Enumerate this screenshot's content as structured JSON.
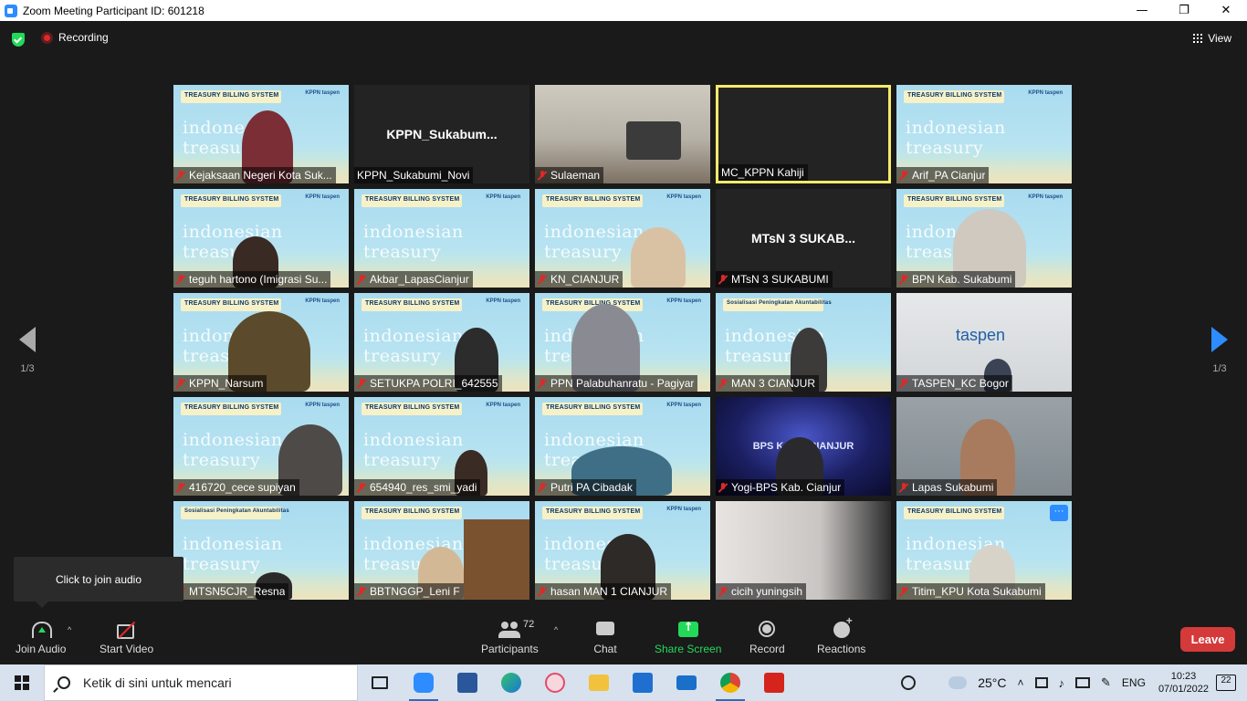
{
  "window": {
    "title": "Zoom Meeting Participant ID: 601218",
    "minimize": "—",
    "maximize": "❐",
    "close": "✕"
  },
  "topbar": {
    "recording_label": "Recording",
    "view_label": "View"
  },
  "pager": {
    "left_label": "1/3",
    "right_label": "1/3"
  },
  "banner": {
    "treasury": "TREASURY BILLING SYSTEM",
    "sosialisasi": "Sosialisasi Peningkatan Akuntabilitas",
    "logo": "KPPN  taspen",
    "watermark": "indonesian treasury"
  },
  "tiles": [
    {
      "name": "Kejaksaan Negeri Kota Suk...",
      "center": "",
      "muted": true
    },
    {
      "name": "KPPN_Sukabumi_Novi",
      "center": "KPPN_Sukabum...",
      "muted": false
    },
    {
      "name": "Sulaeman",
      "center": "",
      "muted": true
    },
    {
      "name": "MC_KPPN Kahiji",
      "center": "",
      "muted": false
    },
    {
      "name": "Arif_PA Cianjur",
      "center": "",
      "muted": true
    },
    {
      "name": "teguh hartono (Imigrasi Su...",
      "center": "",
      "muted": true
    },
    {
      "name": "Akbar_LapasCianjur",
      "center": "",
      "muted": true
    },
    {
      "name": "KN_CIANJUR",
      "center": "",
      "muted": true
    },
    {
      "name": "MTsN 3 SUKABUMI",
      "center": "MTsN 3 SUKAB...",
      "muted": true
    },
    {
      "name": "BPN Kab. Sukabumi",
      "center": "",
      "muted": true
    },
    {
      "name": "KPPN_Narsum",
      "center": "",
      "muted": true
    },
    {
      "name": "SETUKPA POLRI_642555",
      "center": "",
      "muted": true
    },
    {
      "name": "PPN Palabuhanratu - Pagiyar",
      "center": "",
      "muted": true
    },
    {
      "name": "MAN 3 CIANJUR",
      "center": "",
      "muted": true
    },
    {
      "name": "TASPEN_KC Bogor",
      "center": "taspen",
      "muted": true
    },
    {
      "name": "416720_cece supiyan",
      "center": "",
      "muted": true
    },
    {
      "name": "654940_res_smi_yadi",
      "center": "",
      "muted": true
    },
    {
      "name": "Putri PA Cibadak",
      "center": "",
      "muted": true
    },
    {
      "name": "Yogi-BPS Kab. Cianjur",
      "center": "BPS K      TEN CIANJUR",
      "muted": true
    },
    {
      "name": "Lapas Sukabumi",
      "center": "",
      "muted": true
    },
    {
      "name": "MTSN5CJR_Resna",
      "center": "",
      "muted": true
    },
    {
      "name": "BBTNGGP_Leni F",
      "center": "",
      "muted": true
    },
    {
      "name": "hasan MAN 1 CIANJUR",
      "center": "",
      "muted": true
    },
    {
      "name": "cicih yuningsih",
      "center": "",
      "muted": true
    },
    {
      "name": "Titim_KPU Kota Sukabumi",
      "center": "",
      "muted": true
    }
  ],
  "tooltip": {
    "text": "Click to join audio"
  },
  "toolbar": {
    "join_audio": "Join Audio",
    "start_video": "Start Video",
    "participants": "Participants",
    "participants_count": "72",
    "chat": "Chat",
    "share_screen": "Share Screen",
    "record": "Record",
    "reactions": "Reactions",
    "leave": "Leave",
    "caret": "^",
    "more": "···"
  },
  "taskbar": {
    "search_placeholder": "Ketik di sini untuk mencari",
    "temperature": "25°C",
    "language": "ENG",
    "time": "10:23",
    "date": "07/01/2022",
    "notifications": "22"
  },
  "colors": {
    "accent": "#2d8cff",
    "green": "#23d959",
    "leave": "#d53a3a",
    "active_speaker": "#f5ea6b"
  }
}
